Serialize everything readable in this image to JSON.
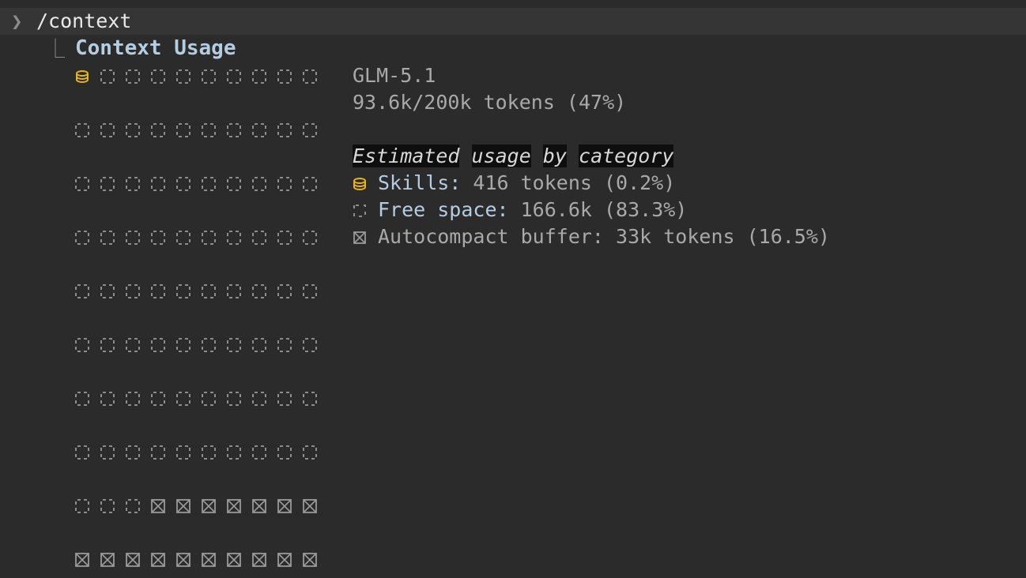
{
  "command_bar": {
    "prompt": "❯",
    "command": "/context"
  },
  "panel": {
    "branch": "⎿",
    "title": "Context Usage"
  },
  "grid": {
    "columns": 10,
    "rows": 10,
    "cells": [
      "skills",
      "free",
      "free",
      "free",
      "free",
      "free",
      "free",
      "free",
      "free",
      "free",
      "free",
      "free",
      "free",
      "free",
      "free",
      "free",
      "free",
      "free",
      "free",
      "free",
      "free",
      "free",
      "free",
      "free",
      "free",
      "free",
      "free",
      "free",
      "free",
      "free",
      "free",
      "free",
      "free",
      "free",
      "free",
      "free",
      "free",
      "free",
      "free",
      "free",
      "free",
      "free",
      "free",
      "free",
      "free",
      "free",
      "free",
      "free",
      "free",
      "free",
      "free",
      "free",
      "free",
      "free",
      "free",
      "free",
      "free",
      "free",
      "free",
      "free",
      "free",
      "free",
      "free",
      "free",
      "free",
      "free",
      "free",
      "free",
      "free",
      "free",
      "free",
      "free",
      "free",
      "free",
      "free",
      "free",
      "free",
      "free",
      "free",
      "free",
      "free",
      "free",
      "free",
      "buffer",
      "buffer",
      "buffer",
      "buffer",
      "buffer",
      "buffer",
      "buffer",
      "buffer",
      "buffer",
      "buffer",
      "buffer",
      "buffer",
      "buffer",
      "buffer",
      "buffer",
      "buffer",
      "buffer"
    ]
  },
  "summary": {
    "model": "GLM-5.1",
    "tokens": "93.6k/200k tokens (47%)"
  },
  "breakdown": {
    "heading_words": [
      "Estimated",
      "usage",
      "by",
      "category"
    ],
    "skills": {
      "icon": "coin-stack-icon",
      "label": "Skills:",
      "value": " 416 tokens (0.2%)"
    },
    "free": {
      "icon": "free-cell-icon",
      "label": "Free space:",
      "value": " 166.6k (83.3%)"
    },
    "buffer": {
      "icon": "buffer-cell-icon",
      "label": "Autocompact buffer:",
      "value": " 33k tokens (16.5%)"
    }
  },
  "colors": {
    "background": "#2b2b2b",
    "command_bar": "#353535",
    "title": "#b4cde0",
    "text": "#a9a9a9",
    "skills_accent": "#e8b21a",
    "cell_stroke": "#9a9a9a"
  }
}
